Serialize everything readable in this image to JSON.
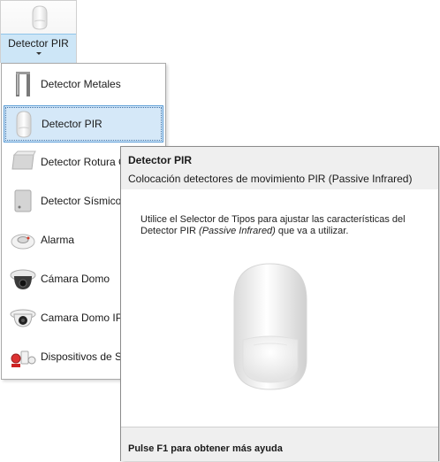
{
  "ribbon": {
    "button_label": "Detector PIR",
    "button_icon": "pir-sensor-icon"
  },
  "menu": {
    "items": [
      {
        "label": "Detector Metales",
        "icon": "metal-detector-icon"
      },
      {
        "label": "Detector PIR",
        "icon": "pir-sensor-icon",
        "selected": true
      },
      {
        "label": "Detector Rotura C",
        "icon": "glass-break-detector-icon"
      },
      {
        "label": "Detector Sísmico",
        "icon": "seismic-detector-icon"
      },
      {
        "label": "Alarma",
        "icon": "alarm-icon"
      },
      {
        "label": "Cámara Domo",
        "icon": "dome-camera-icon"
      },
      {
        "label": "Camara Domo IP",
        "icon": "ip-dome-camera-icon"
      },
      {
        "label": "Dispositivos de Se",
        "icon": "security-devices-icon"
      }
    ]
  },
  "tooltip": {
    "title": "Detector PIR",
    "subtitle": "Colocación detectores de movimiento PIR (Passive Infrared)",
    "body_part1": "Utilice el Selector de Tipos para ajustar las características del Detector PIR ",
    "body_em": "(Passive Infrared)",
    "body_part2": " que va a utilizar.",
    "image_icon": "pir-sensor-large-icon",
    "footer": "Pulse F1 para obtener más ayuda"
  }
}
